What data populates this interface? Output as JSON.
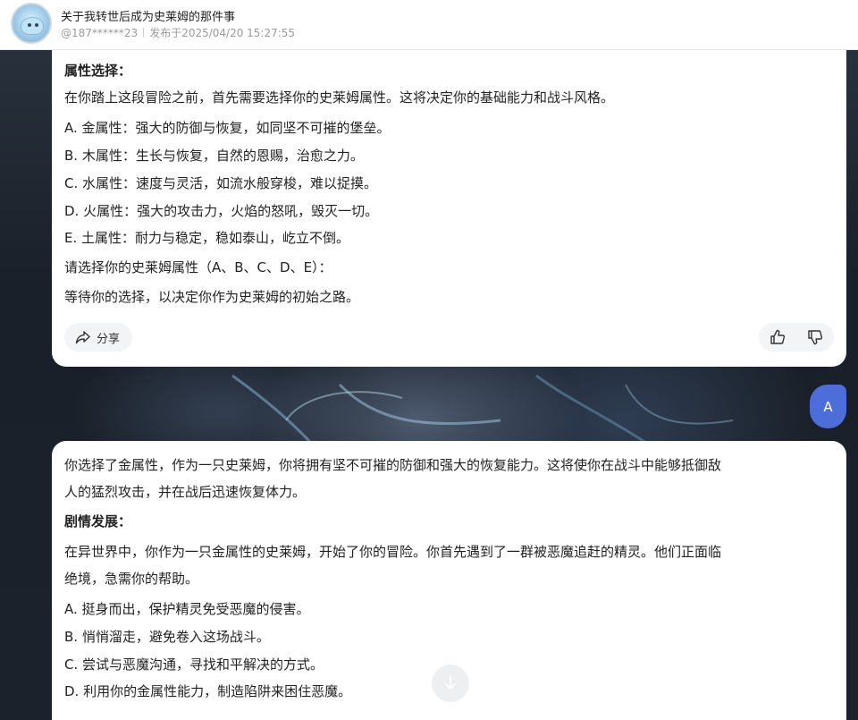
{
  "header": {
    "title": "关于我转世后成为史莱姆的那件事",
    "author": "@187******23",
    "published": "发布于2025/04/20 15:27:55"
  },
  "card1": {
    "lines": [
      "属性选择：",
      "在你踏上这段冒险之前，首先需要选择你的史莱姆属性。这将决定你的基础能力和战斗风格。",
      "A. 金属性：强大的防御与恢复，如同坚不可摧的堡垒。",
      "B. 木属性：生长与恢复，自然的恩赐，治愈之力。",
      "C. 水属性：速度与灵活，如流水般穿梭，难以捉摸。",
      "D. 火属性：强大的攻击力，火焰的怒吼，毁灭一切。",
      "E. 土属性：耐力与稳定，稳如泰山，屹立不倒。",
      "请选择你的史莱姆属性（A、B、C、D、E）：",
      "等待你的选择，以决定你作为史莱姆的初始之路。"
    ],
    "share_label": "分享"
  },
  "user_message": "A",
  "card2": {
    "lines": [
      "你选择了金属性，作为一只史莱姆，你将拥有坚不可摧的防御和强大的恢复能力。这将使你在战斗中能够抵御敌",
      "人的猛烈攻击，并在战后迅速恢复体力。",
      "剧情发展：",
      "在异世界中，你作为一只金属性的史莱姆，开始了你的冒险。你首先遇到了一群被恶魔追赶的精灵。他们正面临",
      "绝境，急需你的帮助。",
      "A. 挺身而出，保护精灵免受恶魔的侵害。",
      "B. 悄悄溜走，避免卷入这场战斗。",
      "C. 尝试与恶魔沟通，寻找和平解决的方式。",
      "D. 利用你的金属性能力，制造陷阱来困住恶魔。"
    ]
  },
  "icons": {
    "share": "share-icon",
    "like": "thumbs-up-icon",
    "dislike": "thumbs-down-icon",
    "scroll": "arrow-down-icon"
  },
  "colors": {
    "user_bubble": "#4d6ed8",
    "card_bg": "#ffffff"
  }
}
